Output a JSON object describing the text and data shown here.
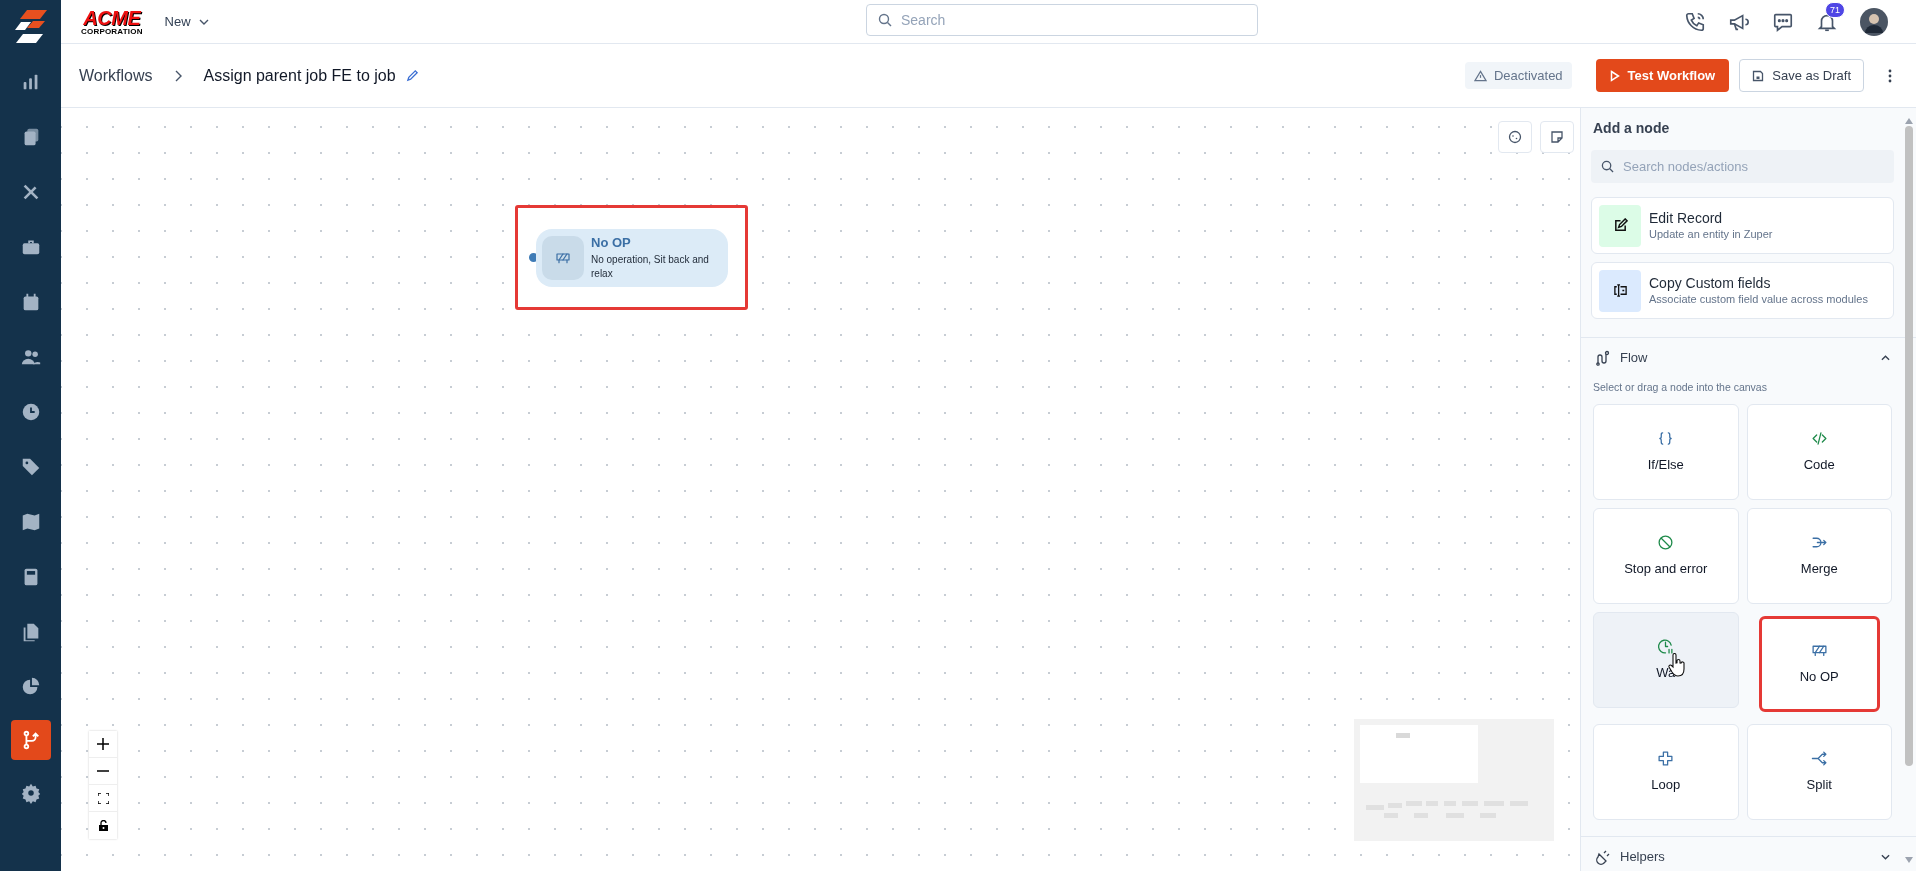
{
  "logo": {
    "title": "ACME",
    "subtitle": "CORPORATION"
  },
  "topbar": {
    "new_menu": "New",
    "search": {
      "placeholder": "Search"
    },
    "notification_count": "71"
  },
  "sidebar": {
    "items": [
      {
        "kind": "chart",
        "selected": false
      },
      {
        "kind": "clipboard",
        "selected": false
      },
      {
        "kind": "tools",
        "selected": false
      },
      {
        "kind": "briefcase",
        "selected": false
      },
      {
        "kind": "calendar",
        "selected": false
      },
      {
        "kind": "users",
        "selected": false
      },
      {
        "kind": "clock",
        "selected": false
      },
      {
        "kind": "tag",
        "selected": false
      },
      {
        "kind": "map",
        "selected": false
      },
      {
        "kind": "calculator",
        "selected": false
      },
      {
        "kind": "documents",
        "selected": false
      },
      {
        "kind": "pie",
        "selected": false
      },
      {
        "kind": "workflow",
        "selected": true
      },
      {
        "kind": "settings",
        "selected": false
      }
    ]
  },
  "breadcrumb": {
    "parent": "Workflows",
    "title": "Assign parent job FE to job"
  },
  "status_badge": "Deactivated",
  "buttons": {
    "test": "Test Workflow",
    "draft": "Save as Draft"
  },
  "canvas": {
    "nodes": [
      {
        "kind": "noop",
        "title": "No OP",
        "description": "No operation, Sit back and relax",
        "highlighted": true
      }
    ]
  },
  "panel": {
    "title": "Add a node",
    "search": {
      "placeholder": "Search nodes/actions"
    },
    "actions": [
      {
        "kind": "edit",
        "title": "Edit Record",
        "description": "Update an entity in Zuper"
      },
      {
        "kind": "copy",
        "title": "Copy Custom fields",
        "description": "Associate custom field value across modules"
      }
    ],
    "sections": [
      {
        "kind": "flow",
        "title": "Flow",
        "expanded": true,
        "hint": "Select or drag a node into the canvas",
        "nodes": [
          {
            "kind": "braces",
            "label": "If/Else",
            "hovered": false,
            "highlighted": false
          },
          {
            "kind": "code",
            "label": "Code",
            "hovered": false,
            "highlighted": false
          },
          {
            "kind": "stop",
            "label": "Stop and error",
            "hovered": false,
            "highlighted": false
          },
          {
            "kind": "merge",
            "label": "Merge",
            "hovered": false,
            "highlighted": false
          },
          {
            "kind": "wait",
            "label": "Wa",
            "hovered": true,
            "highlighted": false
          },
          {
            "kind": "noop",
            "label": "No OP",
            "hovered": false,
            "highlighted": true
          },
          {
            "kind": "loop",
            "label": "Loop",
            "hovered": false,
            "highlighted": false
          },
          {
            "kind": "split",
            "label": "Split",
            "hovered": false,
            "highlighted": false
          }
        ]
      },
      {
        "kind": "helpers",
        "title": "Helpers",
        "expanded": false
      }
    ]
  }
}
